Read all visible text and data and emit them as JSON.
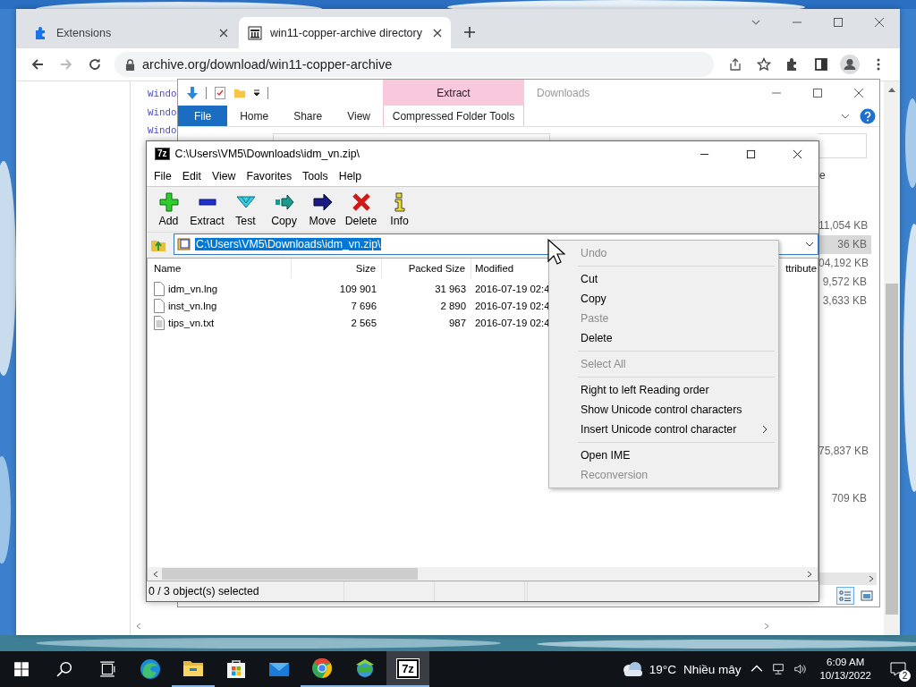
{
  "browser": {
    "tabs": [
      {
        "kind": "extensions",
        "label": "Extensions",
        "selected": false
      },
      {
        "kind": "archive",
        "label": "win11-copper-archive directory",
        "selected": true
      }
    ],
    "url": "archive.org/download/win11-copper-archive",
    "page_lines": [
      "Windo",
      "Windo",
      "Windo"
    ]
  },
  "explorer": {
    "title": "Downloads",
    "context_header": "Extract",
    "context_tab": "Compressed Folder Tools",
    "tabs": [
      {
        "kind": "file",
        "label": "File"
      },
      {
        "kind": "tab",
        "label": "Home"
      },
      {
        "kind": "tab",
        "label": "Share"
      },
      {
        "kind": "tab",
        "label": "View"
      }
    ],
    "column_header": "e",
    "size_groups": [
      [
        {
          "text": "11,054 KB",
          "selected": false
        },
        {
          "text": "36 KB",
          "selected": true
        },
        {
          "text": "04,192 KB",
          "selected": false
        },
        {
          "text": "9,572 KB",
          "selected": false
        },
        {
          "text": "3,633 KB",
          "selected": false
        }
      ],
      [
        {
          "text": "75,837 KB",
          "selected": false
        }
      ],
      [
        {
          "text": "709 KB",
          "selected": false
        }
      ]
    ],
    "views": [
      {
        "kind": "details",
        "selected": true
      },
      {
        "kind": "large_icons",
        "selected": false
      }
    ]
  },
  "archive": {
    "app_icon": "7z",
    "title": "C:\\Users\\VM5\\Downloads\\idm_vn.zip\\",
    "menu": [
      "File",
      "Edit",
      "View",
      "Favorites",
      "Tools",
      "Help"
    ],
    "toolbar": [
      {
        "kind": "add",
        "label": "Add"
      },
      {
        "kind": "extract",
        "label": "Extract"
      },
      {
        "kind": "test",
        "label": "Test"
      },
      {
        "kind": "copy",
        "label": "Copy"
      },
      {
        "kind": "move",
        "label": "Move"
      },
      {
        "kind": "delete",
        "label": "Delete"
      },
      {
        "kind": "info",
        "label": "Info"
      }
    ],
    "path": "C:\\Users\\VM5\\Downloads\\idm_vn.zip\\",
    "path_selected": true,
    "columns": [
      "Name",
      "Size",
      "Packed Size",
      "Modified"
    ],
    "column_5": "ttribute",
    "rows": [
      {
        "kind": "file",
        "name": "idm_vn.lng",
        "size": "109 901",
        "packed": "31 963",
        "modified": "2016-07-19 02:4"
      },
      {
        "kind": "file",
        "name": "inst_vn.lng",
        "size": "7 696",
        "packed": "2 890",
        "modified": "2016-07-19 02:4"
      },
      {
        "kind": "text",
        "name": "tips_vn.txt",
        "size": "2 565",
        "packed": "987",
        "modified": "2016-07-19 02:4"
      }
    ],
    "status": "0 / 3 object(s) selected"
  },
  "context_menu": {
    "items": [
      {
        "kind": "item",
        "label": "Undo",
        "disabled": true
      },
      {
        "kind": "separator"
      },
      {
        "kind": "item",
        "label": "Cut",
        "disabled": false
      },
      {
        "kind": "item",
        "label": "Copy",
        "disabled": false
      },
      {
        "kind": "item",
        "label": "Paste",
        "disabled": true
      },
      {
        "kind": "item",
        "label": "Delete",
        "disabled": false
      },
      {
        "kind": "separator"
      },
      {
        "kind": "item",
        "label": "Select All",
        "disabled": true
      },
      {
        "kind": "separator"
      },
      {
        "kind": "item",
        "label": "Right to left Reading order",
        "disabled": false
      },
      {
        "kind": "item",
        "label": "Show Unicode control characters",
        "disabled": false
      },
      {
        "kind": "submenu",
        "label": "Insert Unicode control character",
        "disabled": false
      },
      {
        "kind": "separator"
      },
      {
        "kind": "item",
        "label": "Open IME",
        "disabled": false
      },
      {
        "kind": "item",
        "label": "Reconversion",
        "disabled": true
      }
    ]
  },
  "taskbar": {
    "apps": [
      {
        "kind": "edge",
        "running": false,
        "selected": false
      },
      {
        "kind": "explorer",
        "running": true,
        "selected": false
      },
      {
        "kind": "store",
        "running": false,
        "selected": false
      },
      {
        "kind": "mail",
        "running": false,
        "selected": false
      },
      {
        "kind": "chrome",
        "running": true,
        "selected": false
      },
      {
        "kind": "idm",
        "running": true,
        "selected": false
      },
      {
        "kind": "sevenzip",
        "label": "7z",
        "running": true,
        "selected": true
      }
    ],
    "weather": {
      "temp": "19°C",
      "condition": "Nhiều mây"
    },
    "time": "6:09 AM",
    "date": "10/13/2022",
    "notifications": "2"
  }
}
